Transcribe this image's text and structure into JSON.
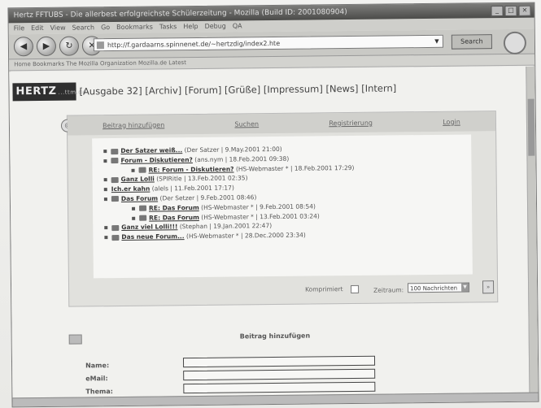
{
  "window": {
    "title": "Hertz FFTUBS - Die allerbest erfolgreichste Schülerzeitung - Mozilla (Build ID: 2001080904)",
    "controls": [
      "_",
      "□",
      "×"
    ]
  },
  "menubar": [
    "File",
    "Edit",
    "View",
    "Search",
    "Go",
    "Bookmarks",
    "Tasks",
    "Help",
    "Debug",
    "QA"
  ],
  "navigation": {
    "back_label": "◀",
    "forward_label": "▶",
    "reload_label": "↻",
    "stop_label": "✕",
    "url": "http://f.gardaarns.spinnenet.de/~hertzdig/index2.hte",
    "search_label": "Search"
  },
  "bookmarks_bar": "Home   Bookmarks   The Mozilla Organization   Mozilla.de   Latest",
  "site": {
    "logo_text": "HERTZ",
    "logo_sub": "...ttm.de",
    "nav": [
      "[Ausgabe 32]",
      "[Archiv]",
      "[Forum]",
      "[Grüße]",
      "[Impressum]",
      "[News]",
      "[Intern]"
    ]
  },
  "forum": {
    "tabs": [
      "Beitrag hinzufügen",
      "Suchen",
      "Registrierung",
      "Login"
    ],
    "threads": [
      {
        "title": "Der Satzer weiß...",
        "meta": "(Der Satzer | 9.May.2001 21:00)",
        "reply": false
      },
      {
        "title": "Forum - Diskutieren?",
        "meta": "(ans.nym | 18.Feb.2001 09:38)",
        "reply": false
      },
      {
        "title": "RE: Forum - Diskutieren?",
        "meta": "(HS-Webmaster * | 18.Feb.2001 17:29)",
        "reply": true
      },
      {
        "title": "Ganz Lolli",
        "meta": "(SPIRitle | 13.Feb.2001 02:35)",
        "reply": false
      },
      {
        "title": "Ich.er kahn",
        "meta": "(alels | 11.Feb.2001 17:17)",
        "reply": false
      },
      {
        "title": "Das Forum",
        "meta": "(Der Setzer | 9.Feb.2001 08:46)",
        "reply": false
      },
      {
        "title": "RE: Das Forum",
        "meta": "(HS-Webmaster * | 9.Feb.2001 08:54)",
        "reply": true
      },
      {
        "title": "RE: Das Forum",
        "meta": "(HS-Webmaster * | 13.Feb.2001 03:24)",
        "reply": true
      },
      {
        "title": "Ganz viel Lolli!!!",
        "meta": "(Stephan | 19.Jan.2001 22:47)",
        "reply": false
      },
      {
        "title": "Das neue Forum...",
        "meta": "(HS-Webmaster * | 28.Dec.2000 23:34)",
        "reply": false
      }
    ],
    "compact_label": "Komprimiert",
    "period_label": "Zeitraum:",
    "period_value": "100 Nachrichten",
    "go_label": "»"
  },
  "form": {
    "title": "Beitrag hinzufügen",
    "fields": [
      "Name:",
      "eMail:",
      "Thema:"
    ]
  }
}
